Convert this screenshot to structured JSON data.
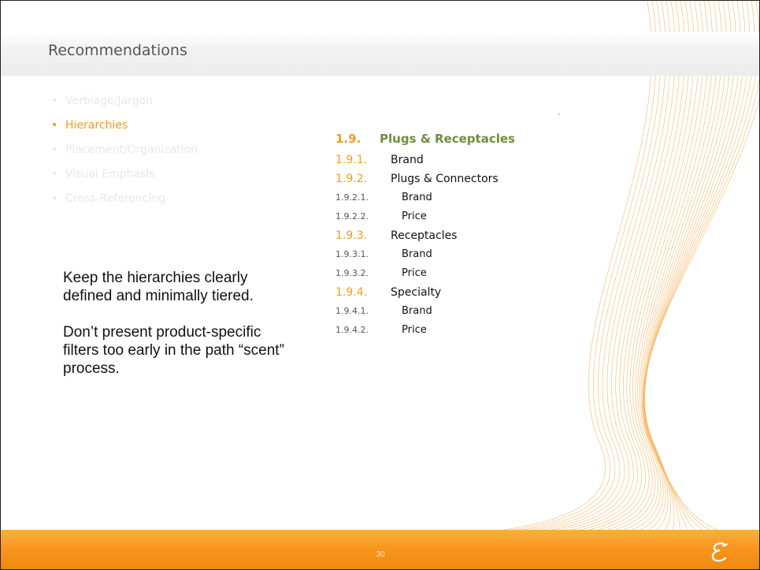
{
  "slide": {
    "title": "Recommendations",
    "page_number": "30",
    "logo_icon": "script-e-logo-icon"
  },
  "bullets": [
    {
      "label": "Verbiage/Jargon",
      "active": false
    },
    {
      "label": "Hierarchies",
      "active": true
    },
    {
      "label": "Placement/Organization",
      "active": false
    },
    {
      "label": "Visual Emphasis",
      "active": false
    },
    {
      "label": "Cross-Referencing",
      "active": false
    }
  ],
  "body": {
    "paragraph_1": "Keep the hierarchies clearly defined and minimally tiered.",
    "paragraph_2": "Don’t present product-specific filters too early in the path “scent” process."
  },
  "outline": [
    {
      "level": 1,
      "num": "1.9.",
      "label": "Plugs & Receptacles"
    },
    {
      "level": 2,
      "num": "1.9.1.",
      "label": "Brand"
    },
    {
      "level": 2,
      "num": "1.9.2.",
      "label": "Plugs & Connectors"
    },
    {
      "level": 3,
      "num": "1.9.2.1.",
      "label": "Brand"
    },
    {
      "level": 3,
      "num": "1.9.2.2.",
      "label": "Price"
    },
    {
      "level": 2,
      "num": "1.9.3.",
      "label": "Receptacles"
    },
    {
      "level": 3,
      "num": "1.9.3.1.",
      "label": "Brand"
    },
    {
      "level": 3,
      "num": "1.9.3.2.",
      "label": "Price"
    },
    {
      "level": 2,
      "num": "1.9.4.",
      "label": "Specialty"
    },
    {
      "level": 3,
      "num": "1.9.4.1.",
      "label": "Brand"
    },
    {
      "level": 3,
      "num": "1.9.4.2.",
      "label": "Price"
    }
  ],
  "colors": {
    "accent_orange": "#f39c1f",
    "heading_green": "#6f8e3e",
    "inactive_bullet": "#e8e8e8",
    "footer_orange": "#f7941d"
  }
}
